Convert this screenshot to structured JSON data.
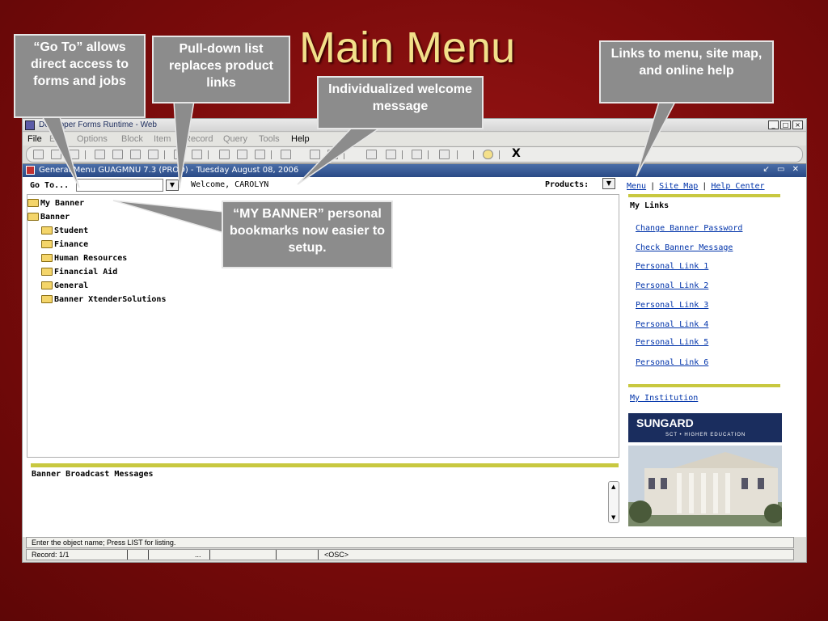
{
  "slide": {
    "title": "Main Menu"
  },
  "callouts": {
    "goto": "“Go To” allows direct access to forms and jobs",
    "pulldown": "Pull-down list replaces product links",
    "welcome": "Individualized welcome message",
    "links": "Links to menu, site map, and online help",
    "mybanner": "“MY BANNER” personal bookmarks now easier to setup."
  },
  "app": {
    "title": "Developer Forms Runtime - Web",
    "menu": [
      "File",
      "Edit",
      "Options",
      "Block",
      "Item",
      "Record",
      "Query",
      "Tools",
      "Help"
    ],
    "toolbar_x": "X"
  },
  "form": {
    "title": "General Menu  GUAGMNU  7.3  (PROD) - Tuesday August 08, 2006",
    "goto_label": "Go To...",
    "goto_value": "",
    "welcome": "Welcome, CAROLYN",
    "products_label": "Products:",
    "tree": {
      "root_mybanner": "My Banner",
      "root_banner": "Banner",
      "children": [
        "Student",
        "Finance",
        "Human Resources",
        "Financial Aid",
        "General",
        "Banner XtenderSolutions"
      ]
    },
    "broadcast_label": "Banner Broadcast Messages"
  },
  "right_panel": {
    "header_links": [
      "Menu",
      "Site Map",
      "Help Center"
    ],
    "mylinks_title": "My Links",
    "links": [
      "Change Banner Password",
      "Check Banner Message",
      "Personal Link 1",
      "Personal Link 2",
      "Personal Link 3",
      "Personal Link 4",
      "Personal Link 5",
      "Personal Link 6"
    ],
    "my_institution": "My Institution",
    "logo_brand": "SUNGARD",
    "logo_sub": "SCT • HIGHER EDUCATION"
  },
  "status": {
    "hint": "Enter the object name; Press LIST for listing.",
    "record": "Record: 1/1",
    "dots": "...",
    "osc": "<OSC>"
  }
}
